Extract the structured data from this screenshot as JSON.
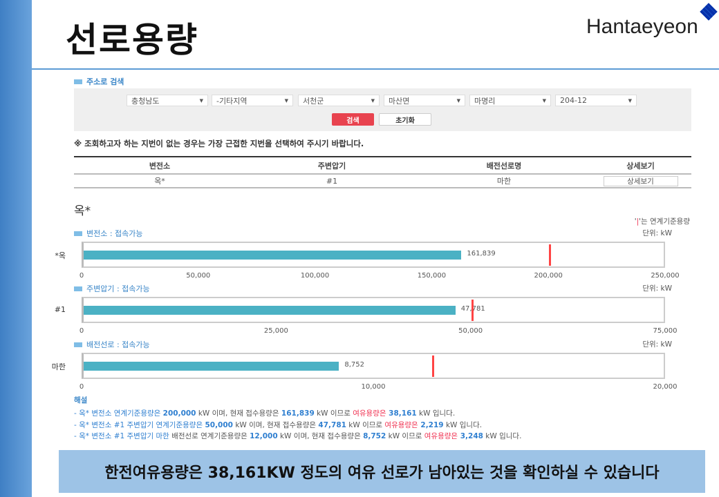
{
  "title": "선로용량",
  "logo": "Hantaeyeon",
  "search": {
    "heading": "주소로 검색",
    "selects": [
      "충청남도",
      "-기타지역",
      "서천군",
      "마산면",
      "마명리",
      "204-12"
    ],
    "search_label": "검색",
    "reset_label": "초기화"
  },
  "note": "※ 조회하고자 하는 지번이 없는 경우는 가장 근접한 지번을 선택하여 주시기 바랍니다.",
  "table": {
    "headers": [
      "변전소",
      "주변압기",
      "배전선로명",
      "상세보기"
    ],
    "row": [
      "옥*",
      "#1",
      "마한"
    ],
    "detail_label": "상세보기"
  },
  "substation": "옥*",
  "legend": "'|'는 연계기준용량",
  "legend_mark": "|",
  "colors": {
    "bar": "#4bb1c4",
    "marker": "#ff4444",
    "accent": "#5b9bd5",
    "search_button": "#e8434f"
  },
  "chart_data": [
    {
      "type": "bar",
      "title": "변전소 : 접속가능",
      "unit": "단위: kW",
      "category": "옥*",
      "value": 161839,
      "value_label": "161,839",
      "reference": 200000,
      "xlim": [
        0,
        250000
      ],
      "ticks": [
        "0",
        "50,000",
        "100,000",
        "150,000",
        "200,000",
        "250,000"
      ]
    },
    {
      "type": "bar",
      "title": "주변압기 : 접속가능",
      "unit": "단위: kW",
      "category": "#1",
      "value": 47781,
      "value_label": "47,781",
      "reference": 50000,
      "xlim": [
        0,
        75000
      ],
      "ticks": [
        "0",
        "25,000",
        "50,000",
        "75,000"
      ]
    },
    {
      "type": "bar",
      "title": "배전선로 : 접속가능",
      "unit": "단위: kW",
      "category": "마한",
      "value": 8752,
      "value_label": "8,752",
      "reference": 12000,
      "xlim": [
        0,
        20000
      ],
      "ticks": [
        "0",
        "10,000",
        "20,000"
      ]
    }
  ],
  "explanation": {
    "heading": "해설",
    "lines": [
      [
        [
          "- 옥* 변전소 연계기준용량은 ",
          "bl"
        ],
        [
          "200,000",
          "num"
        ],
        [
          " kW 이며, 현재 접수용량은 ",
          ""
        ],
        [
          "161,839",
          "num"
        ],
        [
          " kW 이므로 ",
          ""
        ],
        [
          "여유용량은",
          "rd"
        ],
        [
          " 38,161",
          "num"
        ],
        [
          " kW 입니다.",
          ""
        ]
      ],
      [
        [
          "- 옥* 변전소 #1 주변압기 연계기준용량은 ",
          "bl"
        ],
        [
          "50,000",
          "num"
        ],
        [
          " kW 이며, 현재 접수용량은 ",
          ""
        ],
        [
          "47,781",
          "num"
        ],
        [
          " kW 이므로 ",
          ""
        ],
        [
          "여유용량은",
          "rd"
        ],
        [
          " 2,219",
          "num"
        ],
        [
          " kW 입니다.",
          ""
        ]
      ],
      [
        [
          "- 옥* 변전소 #1 주변압기 ",
          "bl"
        ],
        [
          "마한",
          "bl"
        ],
        [
          " 배전선로 연계기준용량은 ",
          ""
        ],
        [
          "12,000",
          "num"
        ],
        [
          " kW 이며, 현재 접수용량은 ",
          ""
        ],
        [
          "8,752",
          "num"
        ],
        [
          " kW 이므로 ",
          ""
        ],
        [
          "여유용량은",
          "rd"
        ],
        [
          " 3,248",
          "num"
        ],
        [
          " kW 입니다.",
          ""
        ]
      ]
    ]
  },
  "banner": "한전여유용량은 38,161KW 정도의 여유 선로가 남아있는 것을 확인하실 수 있습니다"
}
